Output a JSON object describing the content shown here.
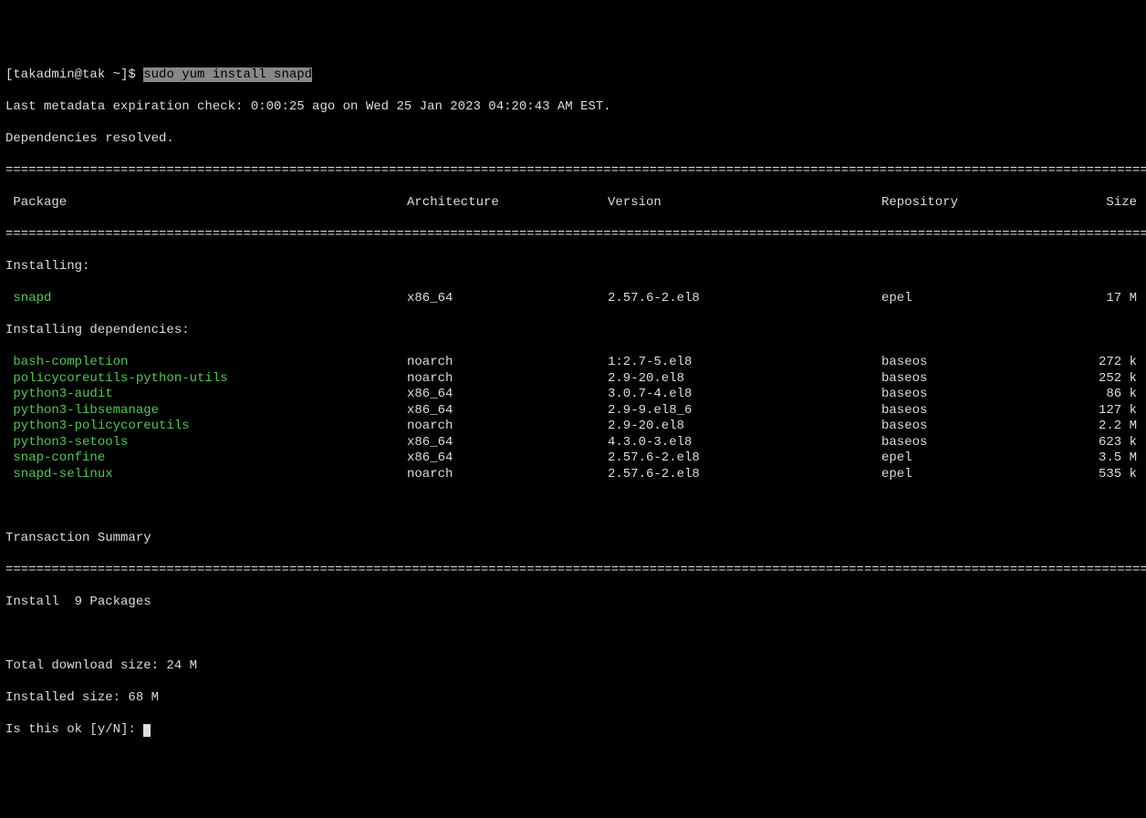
{
  "prompt": {
    "user_host": "[takadmin@tak ~]$ ",
    "command": "sudo yum install snapd"
  },
  "meta_line": "Last metadata expiration check: 0:00:25 ago on Wed 25 Jan 2023 04:20:43 AM EST.",
  "deps_resolved": "Dependencies resolved.",
  "header": {
    "package": " Package",
    "arch": "Architecture",
    "version": "Version",
    "repo": "Repository",
    "size": "Size"
  },
  "installing_label": "Installing:",
  "installing_deps_label": "Installing dependencies:",
  "packages_main": [
    {
      "name": " snapd",
      "arch": "x86_64",
      "version": "2.57.6-2.el8",
      "repo": "epel",
      "size": "17 M"
    }
  ],
  "packages_deps": [
    {
      "name": " bash-completion",
      "arch": "noarch",
      "version": "1:2.7-5.el8",
      "repo": "baseos",
      "size": "272 k"
    },
    {
      "name": " policycoreutils-python-utils",
      "arch": "noarch",
      "version": "2.9-20.el8",
      "repo": "baseos",
      "size": "252 k"
    },
    {
      "name": " python3-audit",
      "arch": "x86_64",
      "version": "3.0.7-4.el8",
      "repo": "baseos",
      "size": "86 k"
    },
    {
      "name": " python3-libsemanage",
      "arch": "x86_64",
      "version": "2.9-9.el8_6",
      "repo": "baseos",
      "size": "127 k"
    },
    {
      "name": " python3-policycoreutils",
      "arch": "noarch",
      "version": "2.9-20.el8",
      "repo": "baseos",
      "size": "2.2 M"
    },
    {
      "name": " python3-setools",
      "arch": "x86_64",
      "version": "4.3.0-3.el8",
      "repo": "baseos",
      "size": "623 k"
    },
    {
      "name": " snap-confine",
      "arch": "x86_64",
      "version": "2.57.6-2.el8",
      "repo": "epel",
      "size": "3.5 M"
    },
    {
      "name": " snapd-selinux",
      "arch": "noarch",
      "version": "2.57.6-2.el8",
      "repo": "epel",
      "size": "535 k"
    }
  ],
  "txn_summary": "Transaction Summary",
  "install_count": "Install  9 Packages",
  "download_size": "Total download size: 24 M",
  "installed_size": "Installed size: 68 M",
  "confirm_prompt": "Is this ok [y/N]: "
}
